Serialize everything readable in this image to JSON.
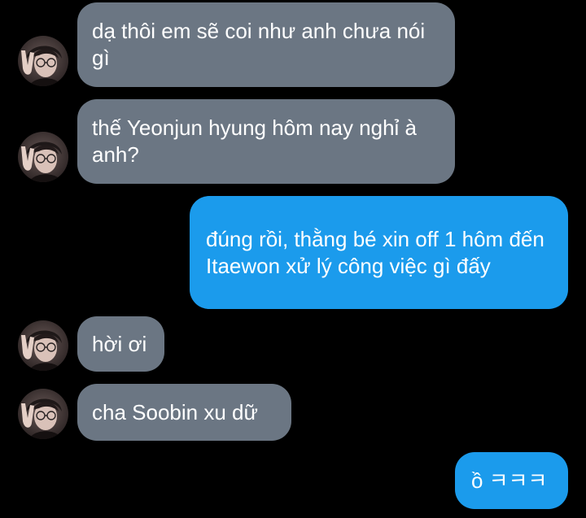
{
  "colors": {
    "background": "#000000",
    "incoming_bubble": "#6b7683",
    "outgoing_bubble": "#1b9bec",
    "text": "#ffffff"
  },
  "messages": [
    {
      "direction": "incoming",
      "avatar": "contact-avatar",
      "text": "dạ thôi em sẽ coi như anh chưa nói gì"
    },
    {
      "direction": "incoming",
      "avatar": "contact-avatar",
      "text": "thế Yeonjun hyung hôm nay nghỉ à anh?"
    },
    {
      "direction": "outgoing",
      "text": "đúng rồi, thằng bé xin off 1 hôm đến Itaewon xử lý công việc gì đấy"
    },
    {
      "direction": "incoming",
      "avatar": "contact-avatar",
      "text": "hời ơi"
    },
    {
      "direction": "incoming",
      "avatar": "contact-avatar",
      "text": "cha Soobin xu dữ"
    },
    {
      "direction": "outgoing",
      "text": "ồ ㅋㅋㅋ"
    }
  ]
}
